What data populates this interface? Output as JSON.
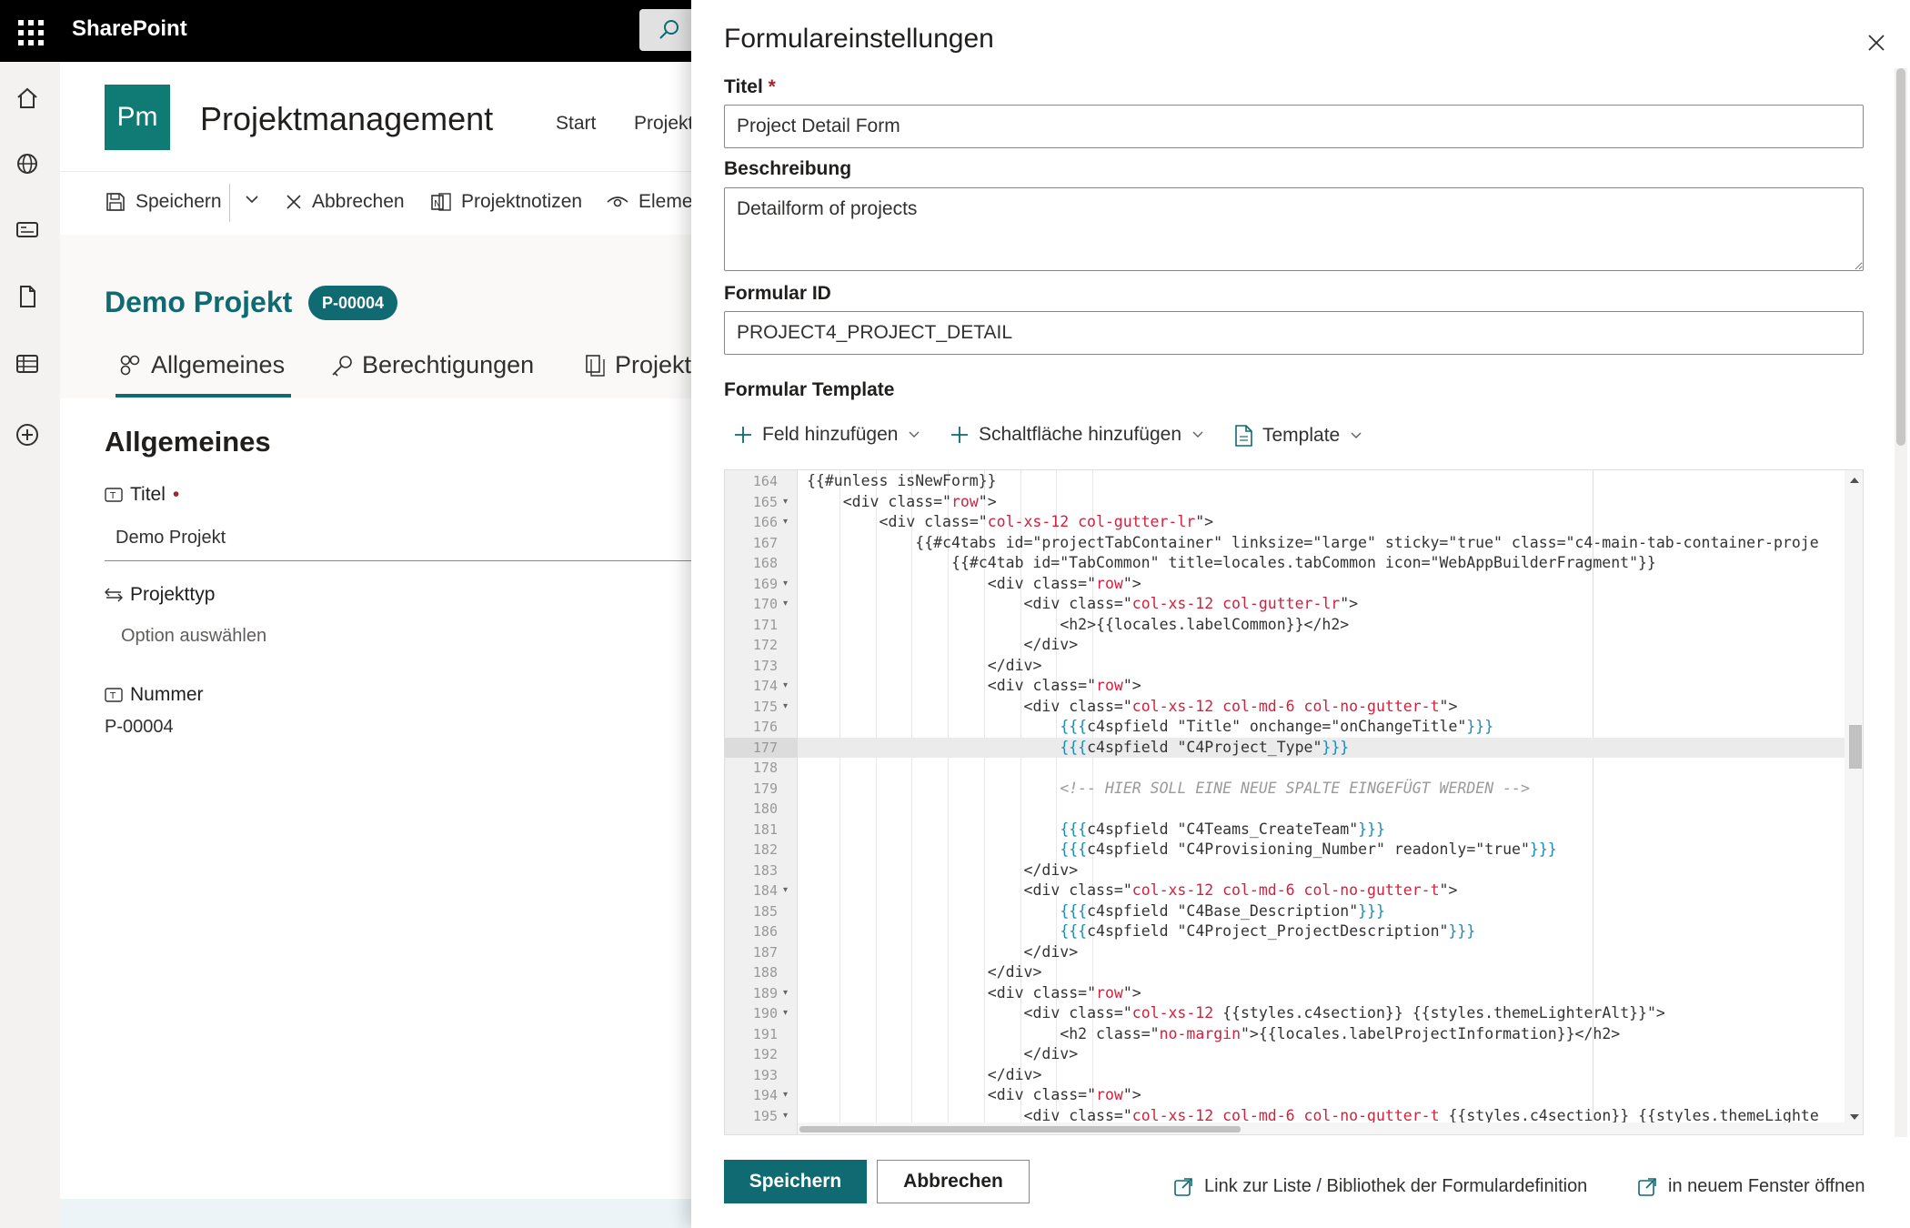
{
  "suite": {
    "title": "SharePoint"
  },
  "site": {
    "logo": "Pm",
    "title": "Projektmanagement",
    "nav": [
      "Start",
      "Projekt"
    ]
  },
  "commandbar": {
    "save": "Speichern",
    "cancel": "Abbrechen",
    "notes": "Projektnotizen",
    "element": "Eleme"
  },
  "page": {
    "project_title": "Demo Projekt",
    "project_badge": "P-00004",
    "tabs": [
      "Allgemeines",
      "Berechtigungen",
      "Projekte"
    ],
    "section_heading": "Allgemeines",
    "fields": [
      {
        "label": "Titel",
        "value": "Demo Projekt",
        "required": true
      },
      {
        "label": "Projekttyp",
        "value": "Option auswählen"
      },
      {
        "label": "Nummer",
        "value": "P-00004"
      }
    ]
  },
  "panel": {
    "title": "Formulareinstellungen",
    "title_label": "Titel",
    "title_required_mark": "*",
    "title_value": "Project Detail Form",
    "description_label": "Beschreibung",
    "description_value": "Detailform of projects",
    "formid_label": "Formular ID",
    "formid_value": "PROJECT4_PROJECT_DETAIL",
    "template_label": "Formular Template",
    "toolbar": {
      "add_field": "Feld hinzufügen",
      "add_button": "Schaltfläche hinzufügen",
      "template": "Template"
    },
    "editor": {
      "active_line": 177,
      "lines": [
        {
          "n": 164,
          "fold": false,
          "indent": 1,
          "html": "{{#unless isNewForm}}"
        },
        {
          "n": 165,
          "fold": true,
          "indent": 2,
          "html": "<div class=\"<s>row</s>\">"
        },
        {
          "n": 166,
          "fold": true,
          "indent": 3,
          "html": "<div class=\"<s>col-xs-12 col-gutter-lr</s>\">"
        },
        {
          "n": 167,
          "fold": false,
          "indent": 4,
          "html": "{{#c4tabs id=\"projectTabContainer\" linksize=\"large\" sticky=\"true\" class=\"c4-main-tab-container-proje"
        },
        {
          "n": 168,
          "fold": false,
          "indent": 5,
          "html": "{{#c4tab id=\"TabCommon\" title=locales.tabCommon icon=\"WebAppBuilderFragment\"}}"
        },
        {
          "n": 169,
          "fold": true,
          "indent": 6,
          "html": "<div class=\"<s>row</s>\">"
        },
        {
          "n": 170,
          "fold": true,
          "indent": 7,
          "html": "<div class=\"<s>col-xs-12 col-gutter-lr</s>\">"
        },
        {
          "n": 171,
          "fold": false,
          "indent": 8,
          "html": "<h2>{{locales.labelCommon}}</h2>"
        },
        {
          "n": 172,
          "fold": false,
          "indent": 7,
          "html": "</div>"
        },
        {
          "n": 173,
          "fold": false,
          "indent": 6,
          "html": "</div>"
        },
        {
          "n": 174,
          "fold": true,
          "indent": 6,
          "html": "<div class=\"<s>row</s>\">"
        },
        {
          "n": 175,
          "fold": true,
          "indent": 7,
          "html": "<div class=\"<s>col-xs-12 col-md-6 col-no-gutter-t</s>\">"
        },
        {
          "n": 176,
          "fold": false,
          "indent": 8,
          "html": "<h>{{{</h>c4spfield \"Title\" onchange=\"onChangeTitle\"<h>}}}</h>"
        },
        {
          "n": 177,
          "fold": false,
          "indent": 8,
          "html": "<h>{{{</h>c4spfield \"C4Project_Type\"<h>}}}</h>"
        },
        {
          "n": 178,
          "fold": false,
          "indent": 8,
          "html": ""
        },
        {
          "n": 179,
          "fold": false,
          "indent": 8,
          "html": "<c><!-- HIER SOLL EINE NEUE SPALTE EINGEFÜGT WERDEN --></c>"
        },
        {
          "n": 180,
          "fold": false,
          "indent": 8,
          "html": ""
        },
        {
          "n": 181,
          "fold": false,
          "indent": 8,
          "html": "<h>{{{</h>c4spfield \"C4Teams_CreateTeam\"<h>}}}</h>"
        },
        {
          "n": 182,
          "fold": false,
          "indent": 8,
          "html": "<h>{{{</h>c4spfield \"C4Provisioning_Number\" readonly=\"true\"<h>}}}</h>"
        },
        {
          "n": 183,
          "fold": false,
          "indent": 7,
          "html": "</div>"
        },
        {
          "n": 184,
          "fold": true,
          "indent": 7,
          "html": "<div class=\"<s>col-xs-12 col-md-6 col-no-gutter-t</s>\">"
        },
        {
          "n": 185,
          "fold": false,
          "indent": 8,
          "html": "<h>{{{</h>c4spfield \"C4Base_Description\"<h>}}}</h>"
        },
        {
          "n": 186,
          "fold": false,
          "indent": 8,
          "html": "<h>{{{</h>c4spfield \"C4Project_ProjectDescription\"<h>}}}</h>"
        },
        {
          "n": 187,
          "fold": false,
          "indent": 7,
          "html": "</div>"
        },
        {
          "n": 188,
          "fold": false,
          "indent": 6,
          "html": "</div>"
        },
        {
          "n": 189,
          "fold": true,
          "indent": 6,
          "html": "<div class=\"<s>row</s>\">"
        },
        {
          "n": 190,
          "fold": true,
          "indent": 7,
          "html": "<div class=\"<s>col-xs-12</s> {{styles.c4section}} {{styles.themeLighterAlt}}\">"
        },
        {
          "n": 191,
          "fold": false,
          "indent": 8,
          "html": "<h2 class=\"<s>no-margin</s>\">{{locales.labelProjectInformation}}</h2>"
        },
        {
          "n": 192,
          "fold": false,
          "indent": 7,
          "html": "</div>"
        },
        {
          "n": 193,
          "fold": false,
          "indent": 6,
          "html": "</div>"
        },
        {
          "n": 194,
          "fold": true,
          "indent": 6,
          "html": "<div class=\"<s>row</s>\">"
        },
        {
          "n": 195,
          "fold": true,
          "indent": 7,
          "html": "<div class=\"<s>col-xs-12 col-md-6 col-no-gutter-t</s> {{styles.c4section}} {{styles.themeLighte"
        }
      ]
    },
    "footer": {
      "save": "Speichern",
      "cancel": "Abbrechen",
      "link_list": "Link zur Liste / Bibliothek der Formulardefinition",
      "open_new_window": "in neuem Fenster öffnen"
    }
  },
  "colors": {
    "brand": "#0f6a72",
    "logo": "#0f7b74",
    "required": "#a4262c",
    "code_string": "#d1213d",
    "code_handlebars": "#1d8ab6",
    "code_comment": "#9a9a9a"
  }
}
